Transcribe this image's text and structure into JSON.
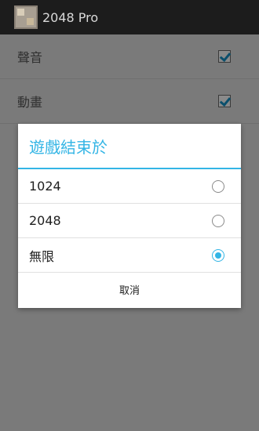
{
  "app": {
    "title": "2048 Pro",
    "icon": "app-icon"
  },
  "settings": {
    "items": [
      {
        "label": "聲音",
        "checked": true
      },
      {
        "label": "動畫",
        "checked": true
      }
    ]
  },
  "dialog": {
    "title": "遊戲結束於",
    "options": [
      {
        "label": "1024",
        "selected": false
      },
      {
        "label": "2048",
        "selected": false
      },
      {
        "label": "無限",
        "selected": true
      }
    ],
    "cancel_label": "取消"
  },
  "colors": {
    "accent": "#33b5e5",
    "action_bar": "#1c1c1c"
  }
}
